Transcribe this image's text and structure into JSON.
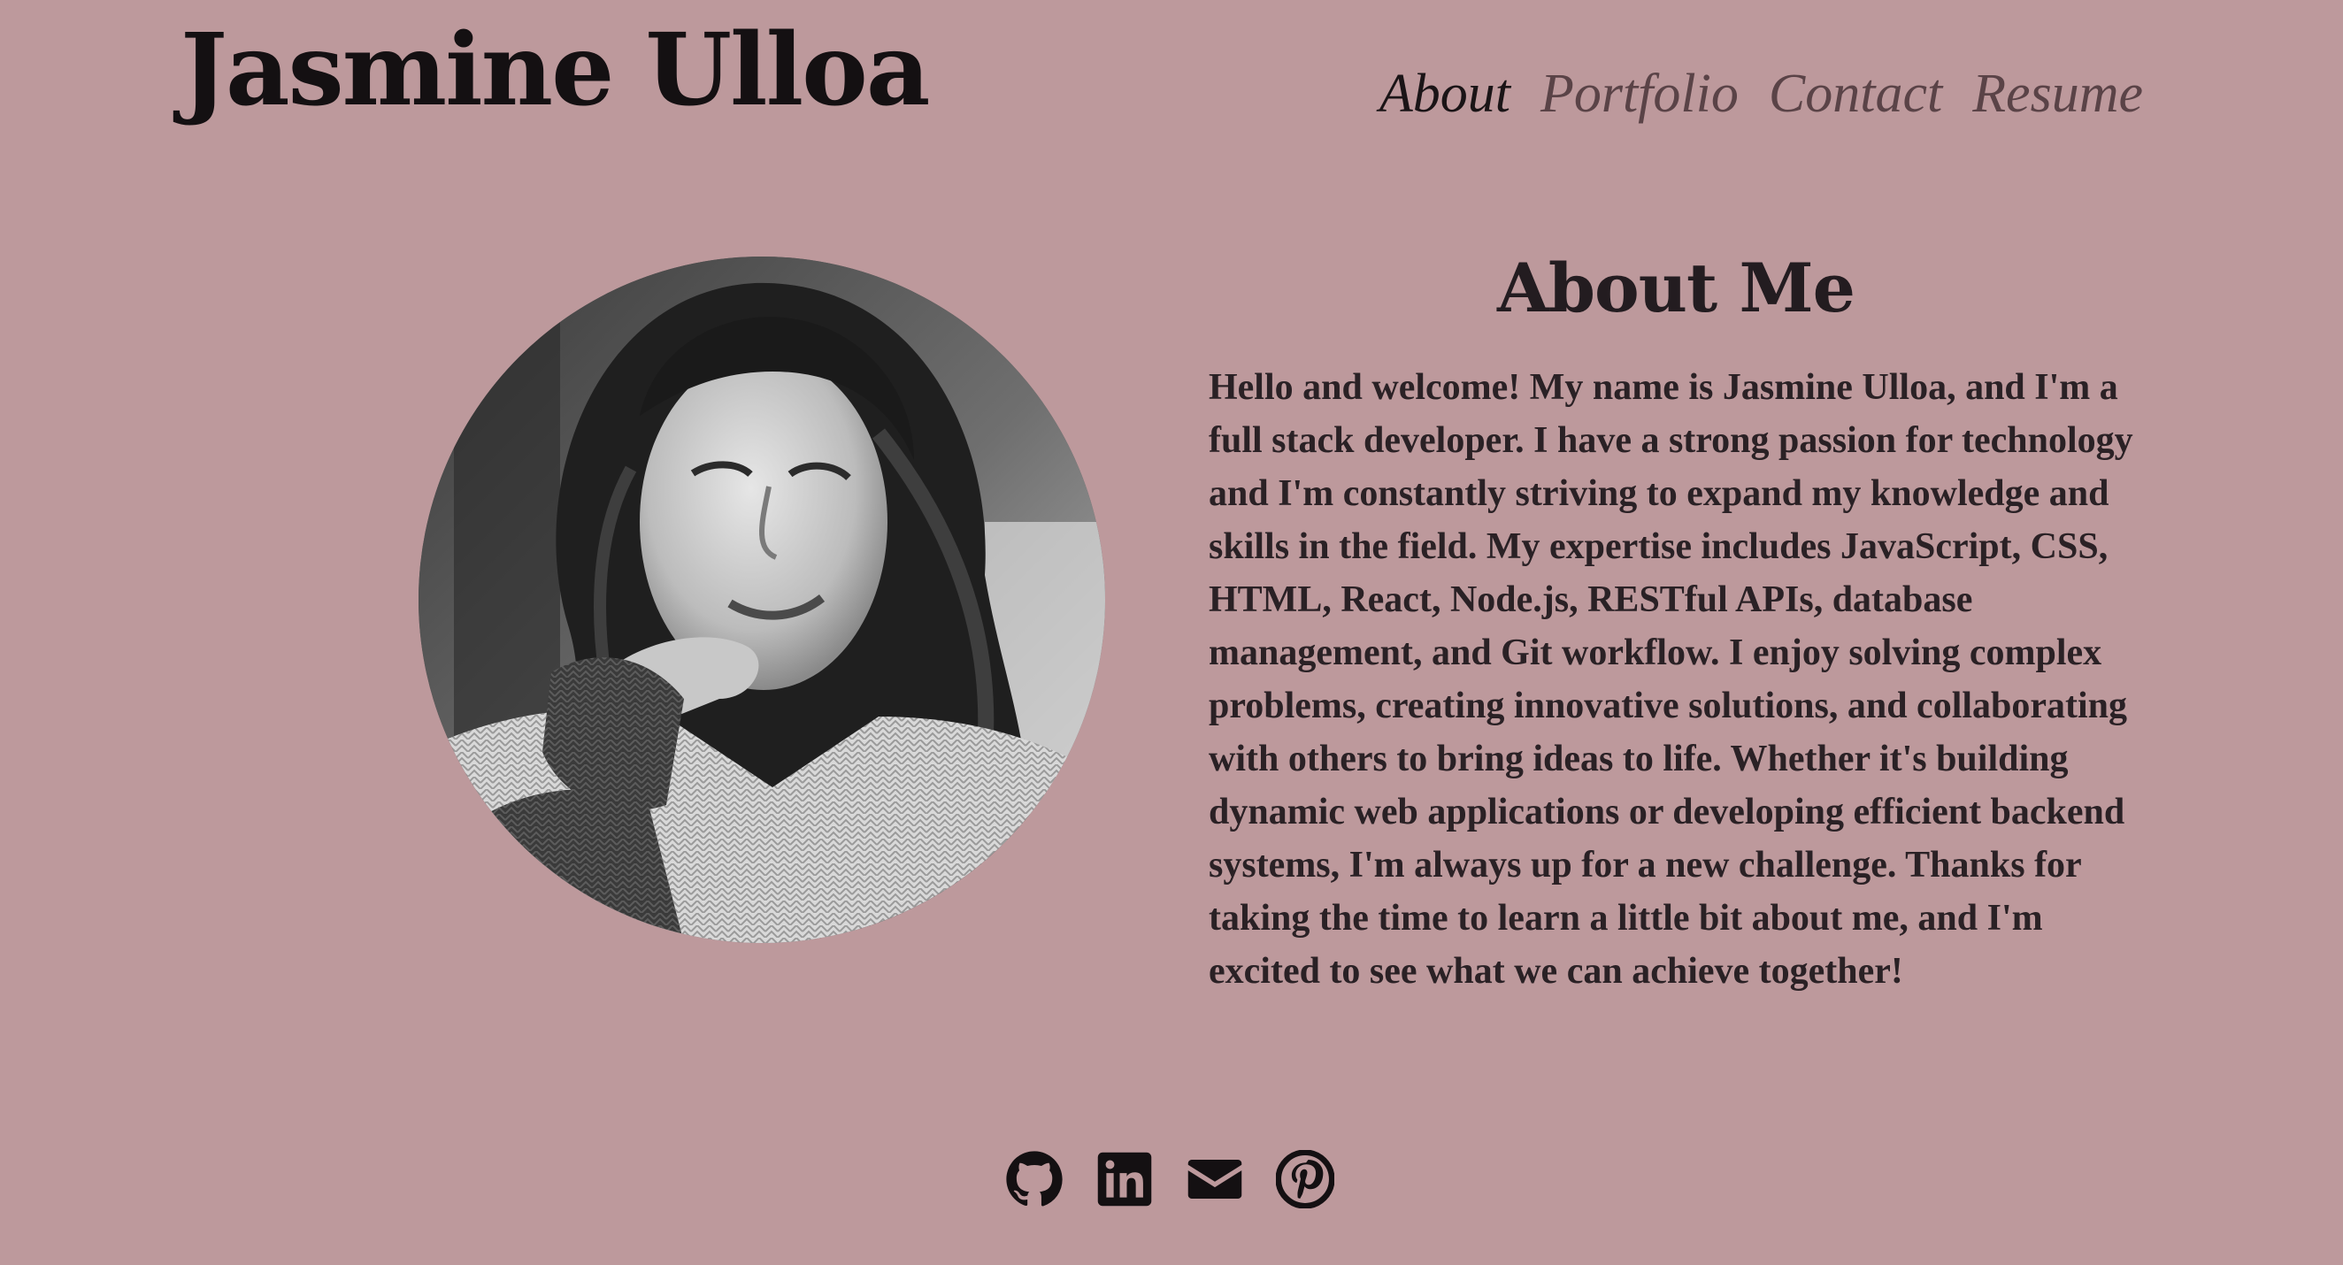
{
  "header": {
    "site_title": "Jasmine Ulloa",
    "nav": [
      {
        "label": "About",
        "active": true
      },
      {
        "label": "Portfolio",
        "active": false
      },
      {
        "label": "Contact",
        "active": false
      },
      {
        "label": "Resume",
        "active": false
      }
    ]
  },
  "about": {
    "heading": "About Me",
    "bio": "Hello and welcome! My name is Jasmine Ulloa, and I'm a full stack developer. I have a strong passion for technology and I'm constantly striving to expand my knowledge and skills in the field. My expertise includes JavaScript, CSS, HTML, React, Node.js, RESTful APIs, database management, and Git workflow. I enjoy solving complex problems, creating innovative solutions, and collaborating with others to bring ideas to life. Whether it's building dynamic web applications or developing efficient backend systems, I'm always up for a new challenge. Thanks for taking the time to learn a little bit about me, and I'm excited to see what we can achieve together!"
  },
  "profile_photo": {
    "style": "grayscale",
    "shape": "circle"
  },
  "social_icons": [
    {
      "icon": "github-icon"
    },
    {
      "icon": "linkedin-icon"
    },
    {
      "icon": "email-icon"
    },
    {
      "icon": "pinterest-icon"
    }
  ],
  "colors": {
    "background": "#bd999c",
    "text": "#1e1a1c",
    "nav_inactive": "#5a4347"
  }
}
